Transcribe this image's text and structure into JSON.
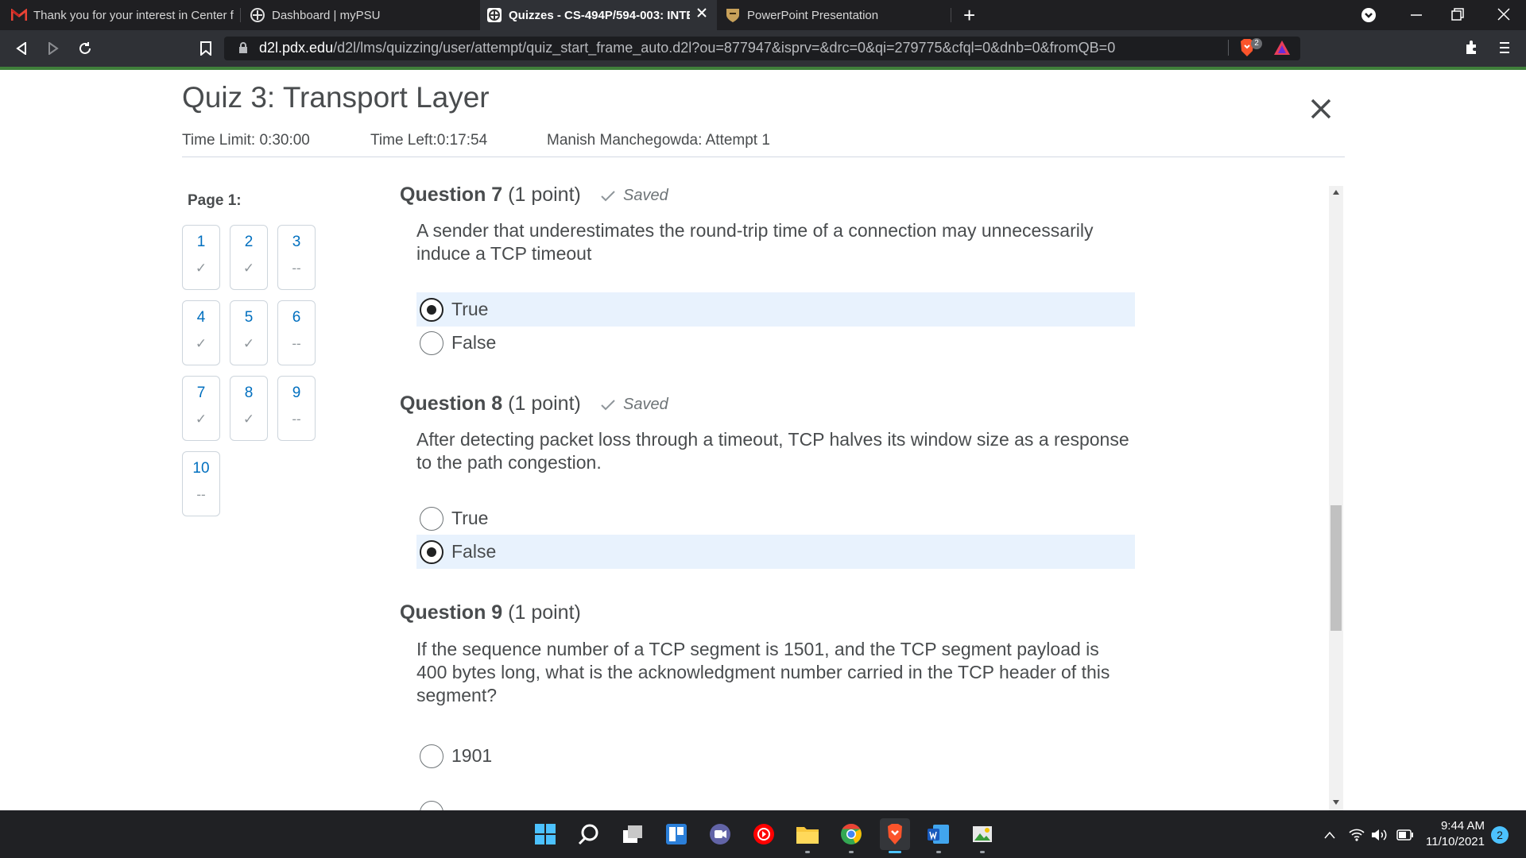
{
  "browser": {
    "tabs": [
      {
        "label": "Thank you for your interest in Center f",
        "icon": "gmail-icon",
        "active": false
      },
      {
        "label": "Dashboard | myPSU",
        "icon": "d2l-icon",
        "active": false
      },
      {
        "label": "Quizzes - CS-494P/594-003: INTE",
        "icon": "d2l-icon",
        "active": true
      },
      {
        "label": "PowerPoint Presentation",
        "icon": "psu-shield-icon",
        "active": false
      }
    ],
    "new_tab_label": "+",
    "url_host": "d2l.pdx.edu",
    "url_path": "/d2l/lms/quizzing/user/attempt/quiz_start_frame_auto.d2l?ou=877947&isprv=&drc=0&qi=279775&cfql=0&dnb=0&fromQB=0",
    "shields_count": "2"
  },
  "quiz": {
    "title": "Quiz 3: Transport Layer",
    "time_limit": "Time Limit: 0:30:00",
    "time_left": "Time Left:0:17:54",
    "attempt": "Manish Manchegowda: Attempt 1",
    "page_label": "Page 1:",
    "nav": [
      {
        "num": "1",
        "status": "✓"
      },
      {
        "num": "2",
        "status": "✓"
      },
      {
        "num": "3",
        "status": "--"
      },
      {
        "num": "4",
        "status": "✓"
      },
      {
        "num": "5",
        "status": "✓"
      },
      {
        "num": "6",
        "status": "--"
      },
      {
        "num": "7",
        "status": "✓"
      },
      {
        "num": "8",
        "status": "✓"
      },
      {
        "num": "9",
        "status": "--"
      },
      {
        "num": "10",
        "status": "--"
      }
    ],
    "questions": [
      {
        "number": "Question 7",
        "points": "(1 point)",
        "saved": "Saved",
        "text": "A sender that underestimates the round-trip time of a connection may unnecessarily induce a TCP timeout",
        "options": [
          {
            "label": "True",
            "selected": true
          },
          {
            "label": "False",
            "selected": false
          }
        ]
      },
      {
        "number": "Question 8",
        "points": "(1 point)",
        "saved": "Saved",
        "text": "After detecting packet loss through a timeout, TCP halves its window size as a response to the path congestion.",
        "options": [
          {
            "label": "True",
            "selected": false
          },
          {
            "label": "False",
            "selected": true
          }
        ]
      },
      {
        "number": "Question 9",
        "points": "(1 point)",
        "saved": "",
        "text": "If the sequence number of a TCP segment is 1501, and the TCP segment payload is 400 bytes long, what is the acknowledgment number carried in the TCP header of this segment?",
        "options": [
          {
            "label": "1901",
            "selected": false
          }
        ]
      }
    ]
  },
  "taskbar": {
    "apps": [
      "windows-start-icon",
      "search-icon",
      "task-view-icon",
      "widgets-icon",
      "teams-chat-icon",
      "youtube-music-icon",
      "file-explorer-icon",
      "chrome-icon",
      "brave-icon",
      "word-icon",
      "photo-app-icon"
    ],
    "time": "9:44 AM",
    "date": "11/10/2021",
    "notification_count": "2"
  },
  "colors": {
    "accent_link": "#006fbf",
    "selected_option_bg": "#e8f2fd",
    "text": "#494c4e",
    "brave_orange": "#fb542b"
  }
}
